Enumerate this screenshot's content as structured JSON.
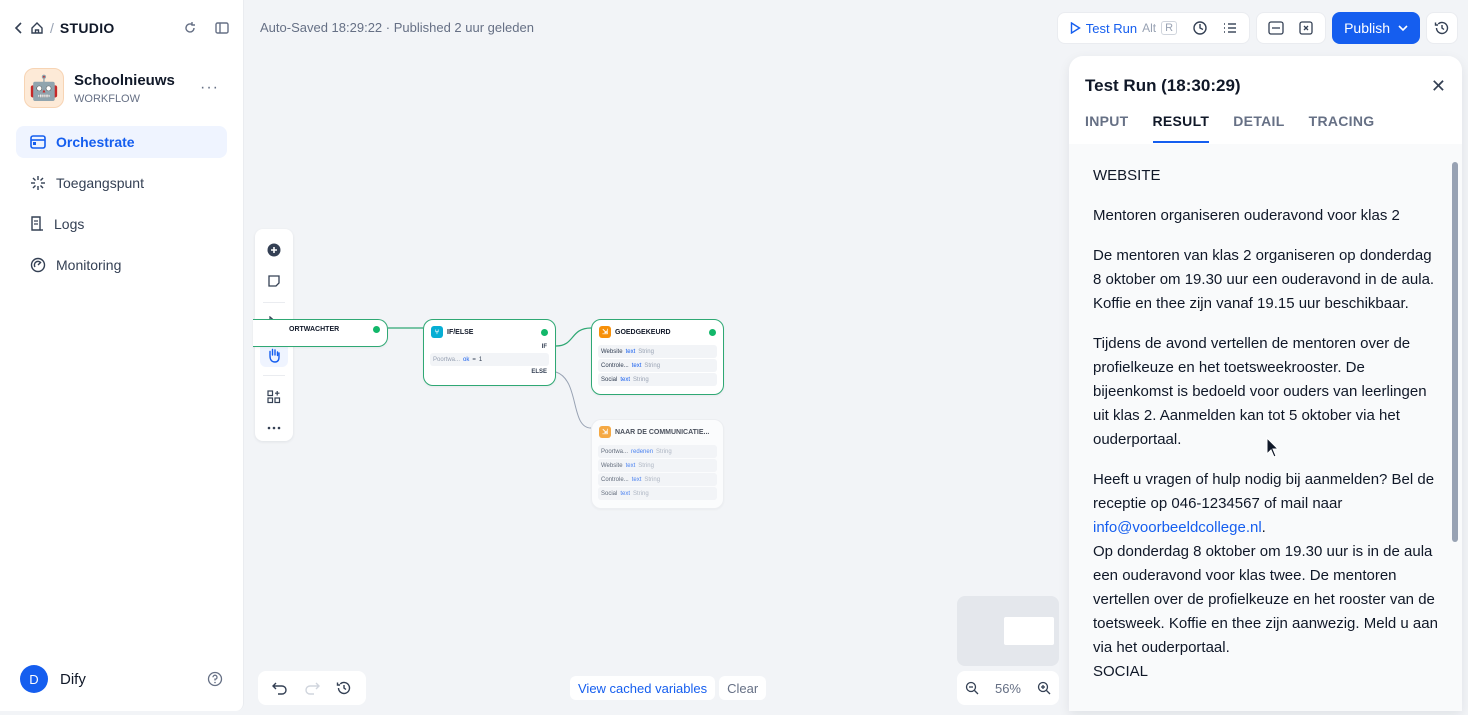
{
  "topbar": {
    "studio": "STUDIO",
    "sep": "/"
  },
  "app": {
    "name": "Schoolnieuws",
    "type": "WORKFLOW",
    "avatar": "🤖"
  },
  "nav": [
    {
      "label": "Orchestrate"
    },
    {
      "label": "Toegangspunt"
    },
    {
      "label": "Logs"
    },
    {
      "label": "Monitoring"
    }
  ],
  "user": {
    "initial": "D",
    "name": "Dify"
  },
  "header": {
    "autosave": "Auto-Saved 18:29:22 · Published 2 uur geleden",
    "test_run": "Test Run",
    "kbd_alt": "Alt",
    "kbd_r": "R",
    "publish": "Publish"
  },
  "nodes": {
    "gatekeeper": {
      "title": "ORTWACHTER"
    },
    "ifelse": {
      "title": "IF/ELSE",
      "if": "IF",
      "else": "ELSE",
      "cond_var": "Poortwa...",
      "cond_field": "ok",
      "cond_op": "=",
      "cond_val": "1"
    },
    "approved": {
      "title": "GOEDGEKEURD",
      "rows": [
        {
          "name": "Website",
          "var": "text",
          "type": "String"
        },
        {
          "name": "Controle...",
          "var": "text",
          "type": "String"
        },
        {
          "name": "Social",
          "var": "text",
          "type": "String"
        }
      ]
    },
    "comm": {
      "title": "NAAR DE COMMUNICATIE...",
      "rows": [
        {
          "name": "Poortwa...",
          "var": "redenen",
          "type": "String"
        },
        {
          "name": "Website",
          "var": "text",
          "type": "String"
        },
        {
          "name": "Controle...",
          "var": "text",
          "type": "String"
        },
        {
          "name": "Social",
          "var": "text",
          "type": "String"
        }
      ]
    }
  },
  "canvas": {
    "view_cached": "View cached variables",
    "clear": "Clear",
    "zoom": "56%"
  },
  "panel": {
    "title": "Test Run (18:30:29)",
    "tabs": [
      "INPUT",
      "RESULT",
      "DETAIL",
      "TRACING"
    ],
    "p1": "WEBSITE",
    "p2": "Mentoren organiseren ouderavond voor klas 2",
    "p3": "De mentoren van klas 2 organiseren op donderdag 8 oktober om 19.30 uur een ouderavond in de aula. Koffie en thee zijn vanaf 19.15 uur beschikbaar.",
    "p4": "Tijdens de avond vertellen de mentoren over de profielkeuze en het toetsweekrooster. De bijeenkomst is bedoeld voor ouders van leerlingen uit klas 2. Aanmelden kan tot 5 oktober via het ouderportaal.",
    "p5a": "Heeft u vragen of hulp nodig bij aanmelden? Bel de receptie op 046-1234567 of mail naar ",
    "p5link": "info@voorbeeldcollege.nl",
    "p5b": ".",
    "p6": "Op donderdag 8 oktober om 19.30 uur is in de aula een ouderavond voor klas twee. De mentoren vertellen over de profielkeuze en het rooster van de toetsweek. Koffie en thee zijn aanwezig. Meld u aan via het ouderportaal.",
    "p7": "SOCIAL"
  },
  "colors": {
    "accent": "#155eef",
    "success": "#12b76a",
    "ifelse": "#06aed4",
    "orange": "#f79009"
  }
}
